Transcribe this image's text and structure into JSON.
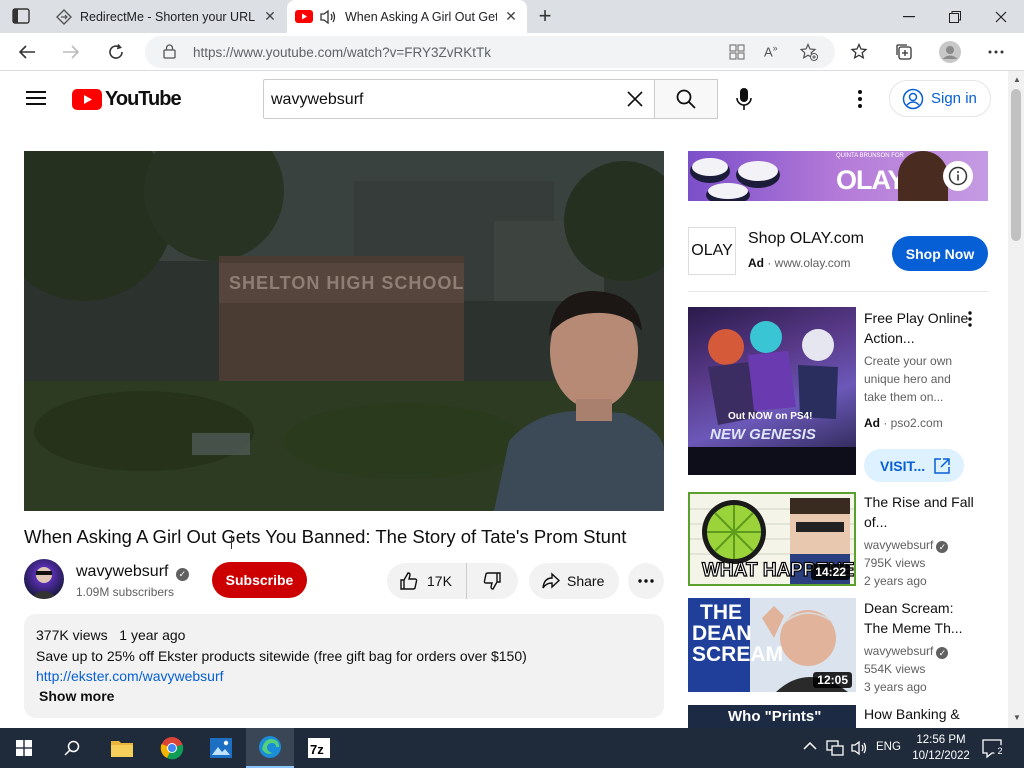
{
  "browser": {
    "tabs": [
      {
        "title": "RedirectMe - Shorten your URL f",
        "active": false
      },
      {
        "title": "When Asking A Girl Out Get",
        "active": true
      }
    ],
    "url": "https://www.youtube.com/watch?v=FRY3ZvRKtTk"
  },
  "youtube": {
    "logo_text": "YouTube",
    "search_query": "wavywebsurf",
    "signin_label": "Sign in"
  },
  "video": {
    "thumbnail_sign": "SHELTON HIGH SCHOOL",
    "title": "When Asking A Girl Out Gets You Banned: The Story of Tate's Prom Stunt",
    "channel": "wavywebsurf",
    "subscribers": "1.09M subscribers",
    "subscribe_label": "Subscribe",
    "likes": "17K",
    "share_label": "Share",
    "views": "377K views",
    "age": "1 year ago",
    "description": "Save up to 25% off Ekster products sitewide (free gift bag for orders over $150)",
    "link": "http://ekster.com/wavywebsurf",
    "show_more": "Show more"
  },
  "sidebar": {
    "banner_brand": "OLAY",
    "banner_small_text": "QUINTA BRUNSON FOR",
    "ad": {
      "logo": "OLAY",
      "title": "Shop OLAY.com",
      "ad_label": "Ad",
      "domain": "www.olay.com",
      "cta": "Shop Now"
    },
    "promo": {
      "title": "Free Play Online Action...",
      "description": "Create your own unique hero and take them on...",
      "ad_label": "Ad",
      "domain": "pso2.com",
      "cta": "VISIT...",
      "thumb_line1": "Out NOW on PS4!",
      "thumb_line2": "NEW GENESIS"
    },
    "videos": [
      {
        "title": "The Rise and Fall of...",
        "channel": "wavywebsurf",
        "views": "795K views",
        "age": "2 years ago",
        "duration": "14:22",
        "thumb_text": "WHAT HAPPENED?"
      },
      {
        "title": "Dean Scream: The Meme Th...",
        "channel": "wavywebsurf",
        "views": "554K views",
        "age": "3 years ago",
        "duration": "12:05",
        "thumb_text": "THE DEAN SCREAM"
      },
      {
        "title": "How Banking &",
        "thumb_text": "Who \"Prints\""
      }
    ]
  },
  "taskbar": {
    "language": "ENG",
    "time": "12:56 PM",
    "date": "10/12/2022",
    "notifications": "2"
  },
  "colors": {
    "youtube_red": "#ff0000",
    "subscribe_red": "#cc0000",
    "link_blue": "#065fd4",
    "taskbar": "#1f2a3a"
  }
}
